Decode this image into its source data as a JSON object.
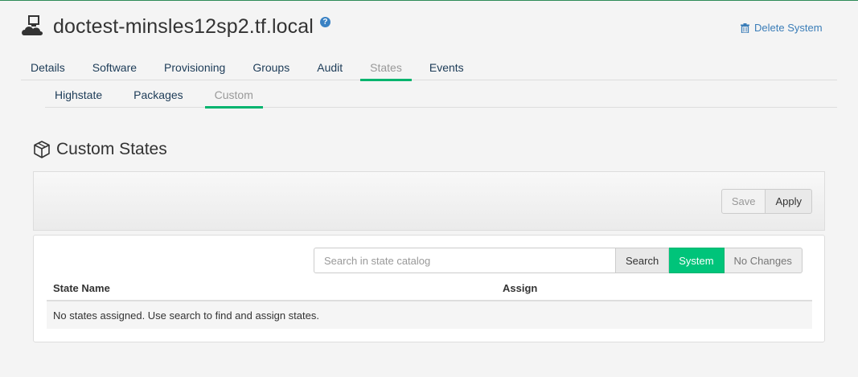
{
  "header": {
    "title": "doctest-minsles12sp2.tf.local",
    "help_label": "?",
    "delete_label": "Delete System"
  },
  "tabs": [
    {
      "label": "Details"
    },
    {
      "label": "Software"
    },
    {
      "label": "Provisioning"
    },
    {
      "label": "Groups"
    },
    {
      "label": "Audit"
    },
    {
      "label": "States",
      "active": true
    },
    {
      "label": "Events"
    }
  ],
  "subtabs": [
    {
      "label": "Highstate"
    },
    {
      "label": "Packages"
    },
    {
      "label": "Custom",
      "active": true
    }
  ],
  "section": {
    "title": "Custom States"
  },
  "toolbar": {
    "save_label": "Save",
    "apply_label": "Apply"
  },
  "search": {
    "placeholder": "Search in state catalog",
    "value": "",
    "search_label": "Search",
    "system_label": "System",
    "no_changes_label": "No Changes"
  },
  "table": {
    "columns": [
      "State Name",
      "Assign"
    ],
    "empty_message": "No states assigned. Use search to find and assign states."
  },
  "colors": {
    "accent": "#00b46e",
    "link": "#3a7db8"
  },
  "icons": {
    "system": "system-icon",
    "help": "help-icon",
    "delete": "trash-icon",
    "section": "cube-icon"
  }
}
